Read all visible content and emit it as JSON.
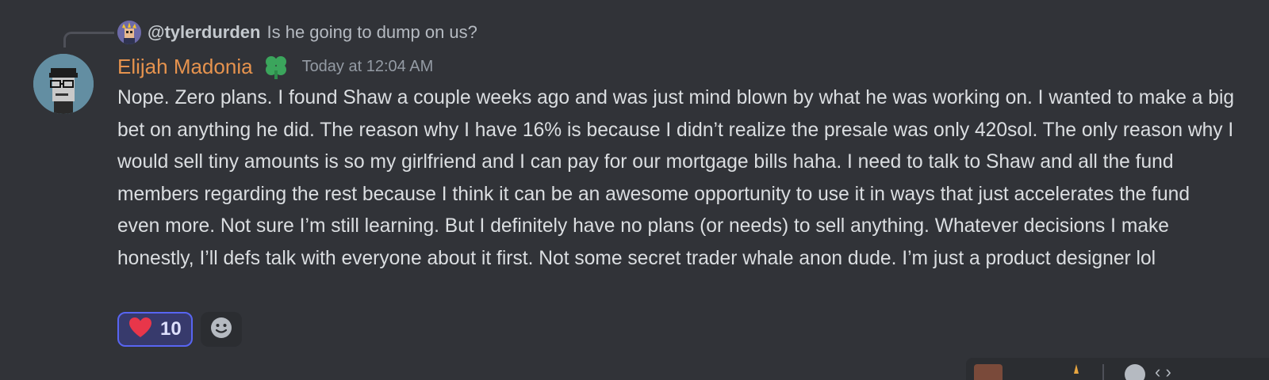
{
  "reply": {
    "username": "@tylerdurden",
    "text": "Is he going to dump on us?"
  },
  "message": {
    "author": "Elijah Madonia",
    "author_color": "#e6934e",
    "role_icon": "green-clover-icon",
    "timestamp": "Today at 12:04 AM",
    "body": "Nope. Zero plans. I found Shaw a couple weeks ago and was just mind blown by what he was working on. I wanted to make a big bet on anything he did. The reason why I have 16% is because I didn’t realize the presale was only 420sol. The only reason why I would sell tiny amounts is so my girlfriend and I can pay for our mortgage bills haha. I need to talk to Shaw and all the fund members regarding the rest because I think it can be an awesome opportunity to use it in ways that just accelerates the fund even more. Not sure I’m still learning. But I definitely have no plans (or needs) to sell anything. Whatever decisions I make honestly, I’ll defs talk with everyone about it first. Not some secret trader whale anon dude. I’m just a product designer lol"
  },
  "reactions": [
    {
      "emoji": "heart-icon",
      "count": "10",
      "active": true
    }
  ],
  "add_reaction_icon": "smiley-icon",
  "colors": {
    "background": "#313338",
    "reaction_active_border": "#5865f2",
    "reaction_active_bg": "#373a6c",
    "heart": "#e8364a",
    "clover": "#3ba55c"
  }
}
